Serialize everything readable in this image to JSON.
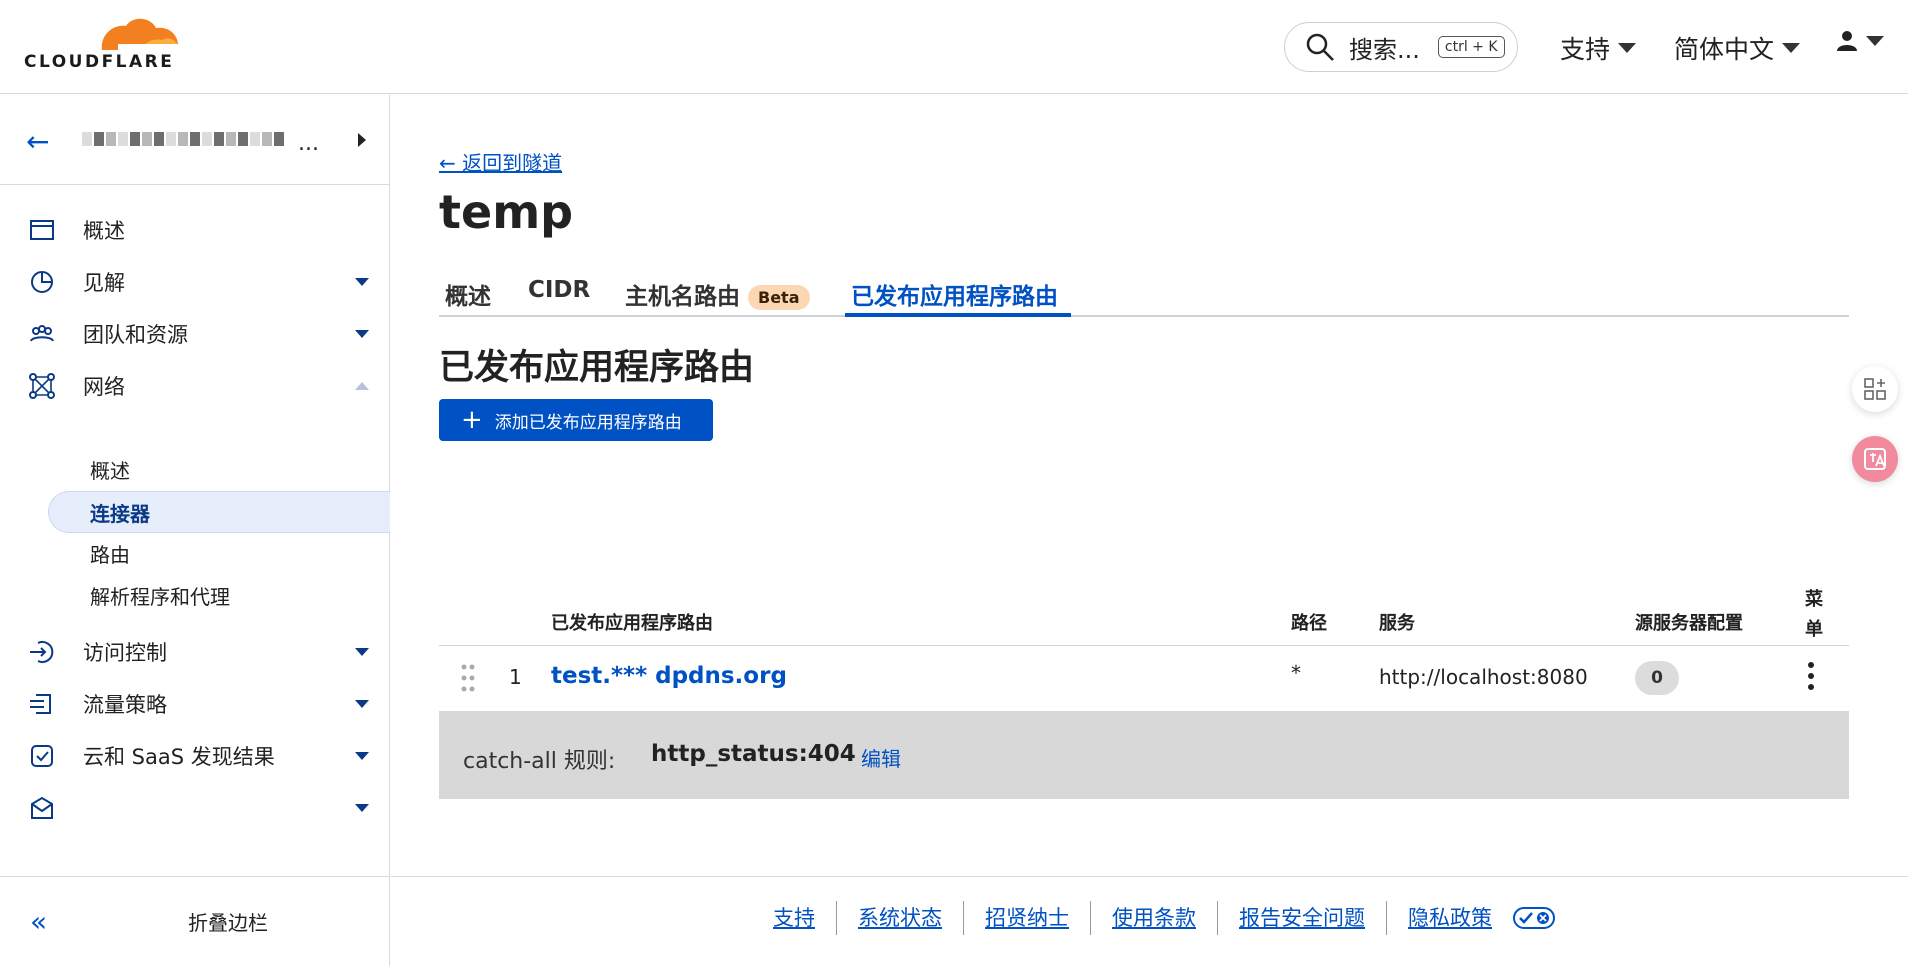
{
  "topbar": {
    "logo_text": "CLOUDFLARE",
    "search_label": "搜索...",
    "search_shortcut": "ctrl + K",
    "support": "支持",
    "language": "简体中文"
  },
  "sidebar": {
    "collapse_label": "折叠边栏",
    "items": [
      {
        "label": "概述"
      },
      {
        "label": "见解"
      },
      {
        "label": "团队和资源"
      },
      {
        "label": "网络"
      },
      {
        "label": "访问控制"
      },
      {
        "label": "流量策略"
      },
      {
        "label": "云和 SaaS 发现结果"
      },
      {
        "label": ""
      }
    ],
    "network_sub": [
      {
        "label": "概述"
      },
      {
        "label": "连接器"
      },
      {
        "label": "路由"
      },
      {
        "label": "解析程序和代理"
      }
    ]
  },
  "main": {
    "back_link": "← 返回到隧道",
    "title": "temp",
    "tabs": [
      {
        "label": "概述"
      },
      {
        "label": "CIDR"
      },
      {
        "label": "主机名路由"
      },
      {
        "label": "已发布应用程序路由"
      }
    ],
    "beta_badge": "Beta",
    "section_title": "已发布应用程序路由",
    "add_button": "添加已发布应用程序路由",
    "table": {
      "headers": {
        "route": "已发布应用程序路由",
        "path": "路径",
        "service": "服务",
        "origin": "源服务器配置",
        "menu": "菜单"
      },
      "rows": [
        {
          "index": "1",
          "hostname": "test.*** dpdns.org",
          "path": "*",
          "service": "http://localhost:8080",
          "origin_count": "0"
        }
      ]
    },
    "catch_all": {
      "label": "catch-all 规则:",
      "value": "http_status:404",
      "edit": "编辑"
    }
  },
  "footer": {
    "links": [
      "支持",
      "系统状态",
      "招贤纳士",
      "使用条款",
      "报告安全问题",
      "隐私政策"
    ]
  },
  "colors": {
    "accent": "#0051c3",
    "cloud_orange": "#f38020",
    "beta_bg": "#fbd7b4"
  }
}
